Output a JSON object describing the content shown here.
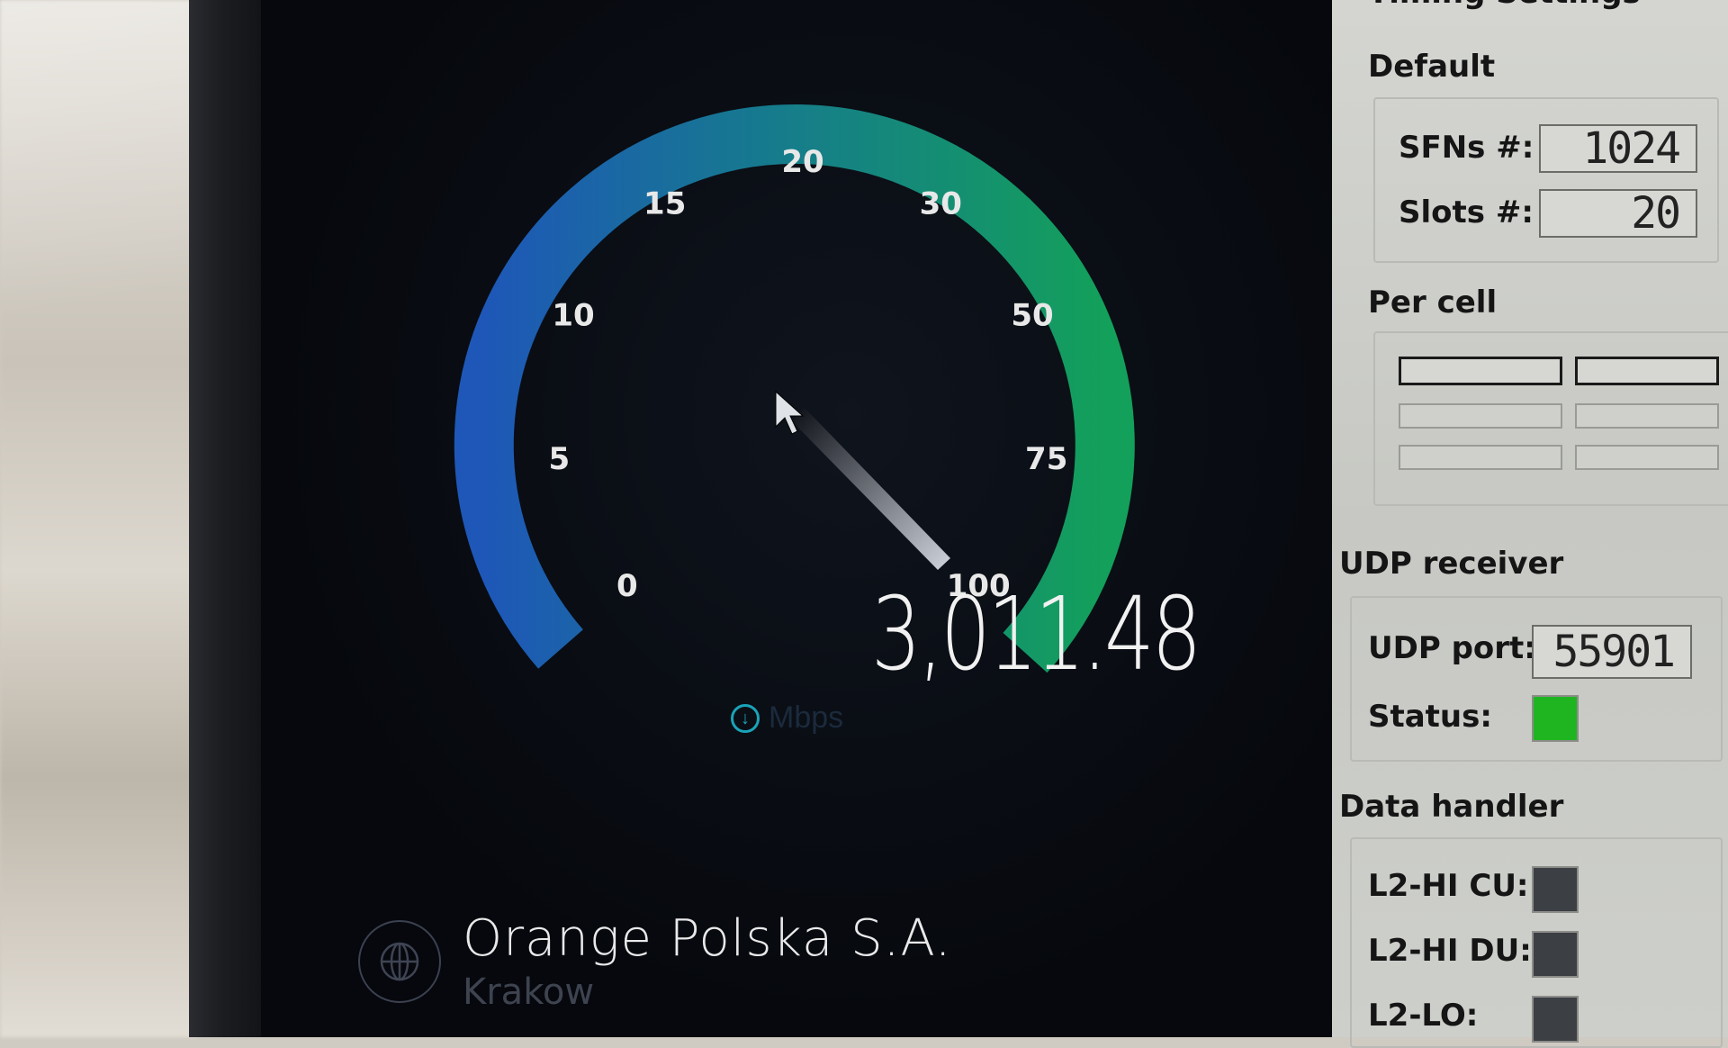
{
  "gauge": {
    "tick_labels": [
      "0",
      "5",
      "10",
      "15",
      "20",
      "30",
      "50",
      "75",
      "100"
    ],
    "speed": "3,011.48",
    "unit": "Mbps",
    "colors": {
      "start": "#1e57b8",
      "end": "#13a05a"
    }
  },
  "provider": {
    "name": "Orange Polska S.A.",
    "city": "Krakow"
  },
  "panel": {
    "section_timing": "Timing Settings",
    "default_label": "Default",
    "sfns_label": "SFNs #:",
    "sfns_value": "1024",
    "slots_label": "Slots #:",
    "slots_value": "20",
    "per_cell_label": "Per cell",
    "udp_section": "UDP receiver",
    "udp_port_label": "UDP port:",
    "udp_port_value": "55901",
    "status_label": "Status:",
    "status_color": "#1fb521",
    "data_handler_section": "Data handler",
    "l2_hi_cu_label": "L2-HI CU:",
    "l2_hi_du_label": "L2-HI DU:",
    "l2_lo_label": "L2-LO:"
  }
}
